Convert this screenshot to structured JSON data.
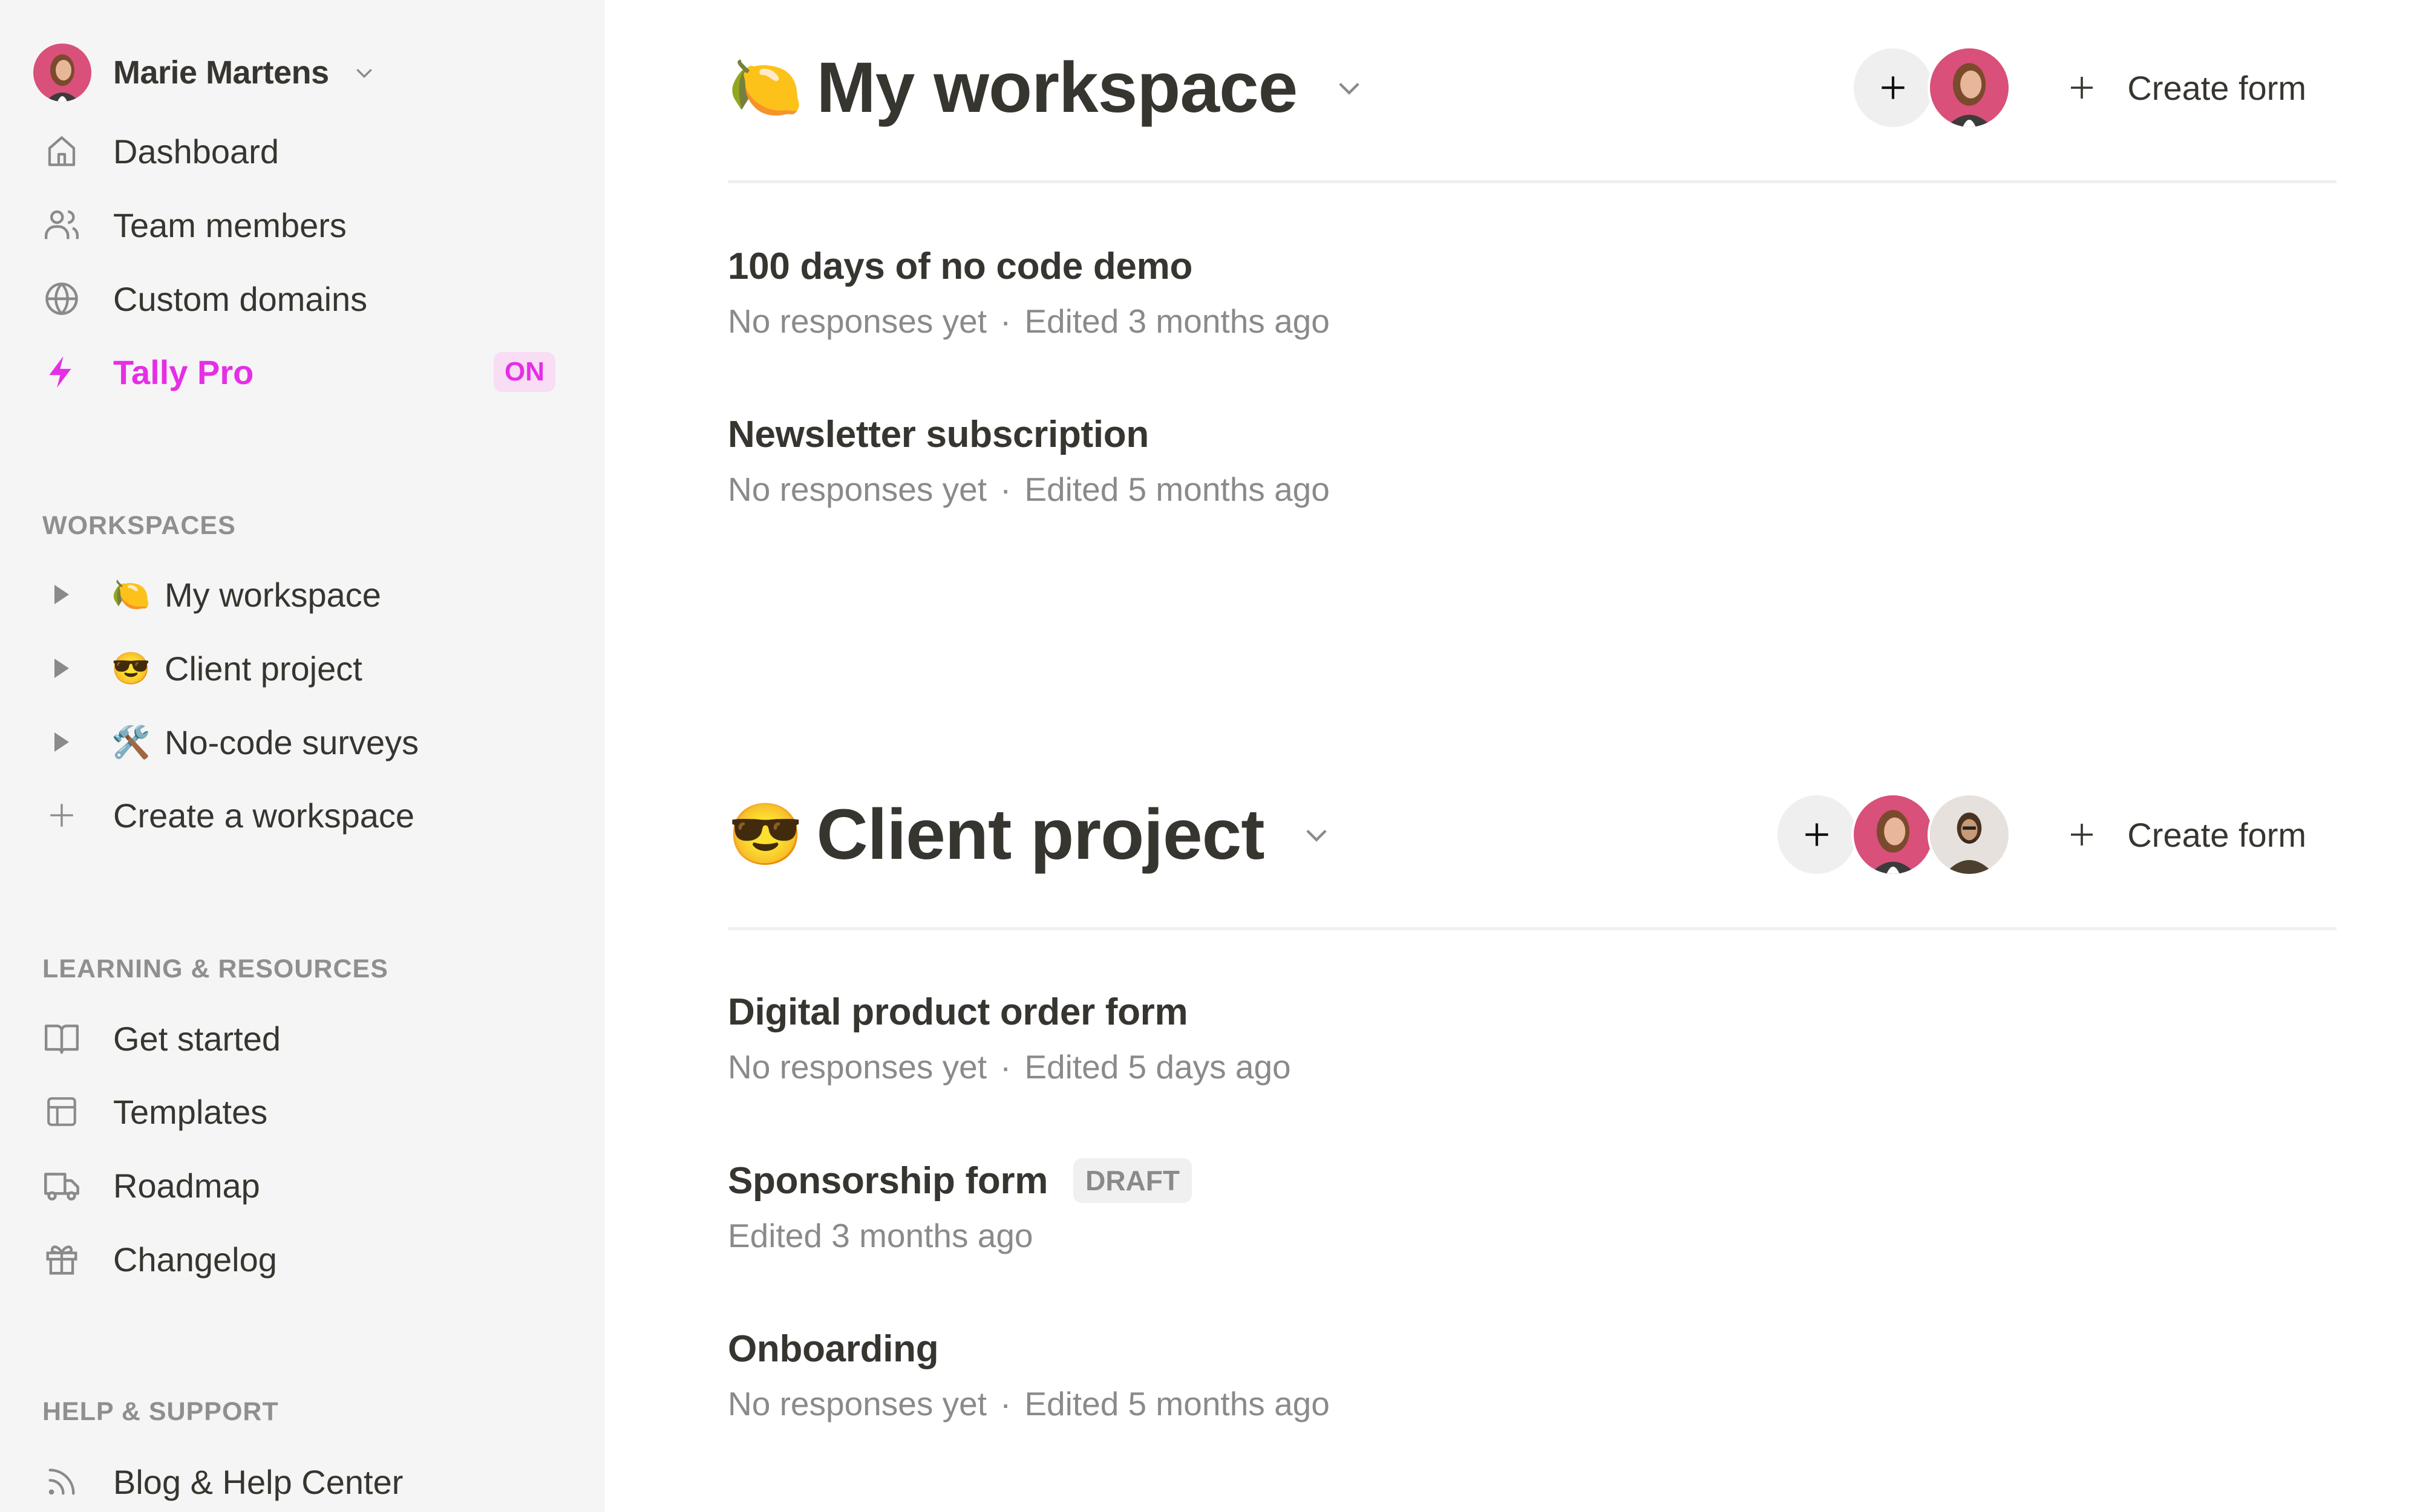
{
  "user": {
    "name": "Marie Martens",
    "avatar": "user-avatar-marie"
  },
  "nav": [
    {
      "label": "Dashboard",
      "icon": "home-icon"
    },
    {
      "label": "Team members",
      "icon": "users-icon"
    },
    {
      "label": "Custom domains",
      "icon": "globe-icon"
    },
    {
      "label": "Tally Pro",
      "icon": "lightning-icon",
      "badge": "ON"
    }
  ],
  "sections": {
    "workspaces": "WORKSPACES",
    "learning": "LEARNING & RESOURCES",
    "help": "HELP & SUPPORT"
  },
  "workspaces_list": [
    {
      "emoji": "🍋",
      "label": "My workspace"
    },
    {
      "emoji": "😎",
      "label": "Client project"
    },
    {
      "emoji": "🛠️",
      "label": "No-code surveys"
    }
  ],
  "create_workspace": "Create a workspace",
  "learning_items": [
    {
      "label": "Get started",
      "icon": "book-icon"
    },
    {
      "label": "Templates",
      "icon": "layout-icon"
    },
    {
      "label": "Roadmap",
      "icon": "truck-icon"
    },
    {
      "label": "Changelog",
      "icon": "gift-icon"
    }
  ],
  "help_items": [
    {
      "label": "Blog & Help Center",
      "icon": "rss-icon"
    }
  ],
  "main": {
    "workspaces": [
      {
        "emoji": "🍋",
        "title": "My workspace",
        "create_label": "Create form",
        "members": [
          "Marie Martens"
        ],
        "forms": [
          {
            "title": "100 days of no code demo",
            "responses": "No responses yet",
            "edited": "Edited 3 months ago"
          },
          {
            "title": "Newsletter subscription",
            "responses": "No responses yet",
            "edited": "Edited 5 months ago"
          }
        ]
      },
      {
        "emoji": "😎",
        "title": "Client project",
        "create_label": "Create form",
        "members": [
          "Marie Martens",
          "Collaborator"
        ],
        "forms": [
          {
            "title": "Digital product order form",
            "responses": "No responses yet",
            "edited": "Edited 5 days ago"
          },
          {
            "title": "Sponsorship form",
            "badge": "DRAFT",
            "edited": "Edited 3 months ago"
          },
          {
            "title": "Onboarding",
            "responses": "No responses yet",
            "edited": "Edited 5 months ago"
          }
        ]
      }
    ],
    "separator": "·"
  },
  "colors": {
    "accent": "#e62ee6",
    "accent_bg": "#f8ddf4",
    "sidebar_bg": "#f5f5f5",
    "text": "#37352f",
    "muted": "#8a8a8a"
  }
}
